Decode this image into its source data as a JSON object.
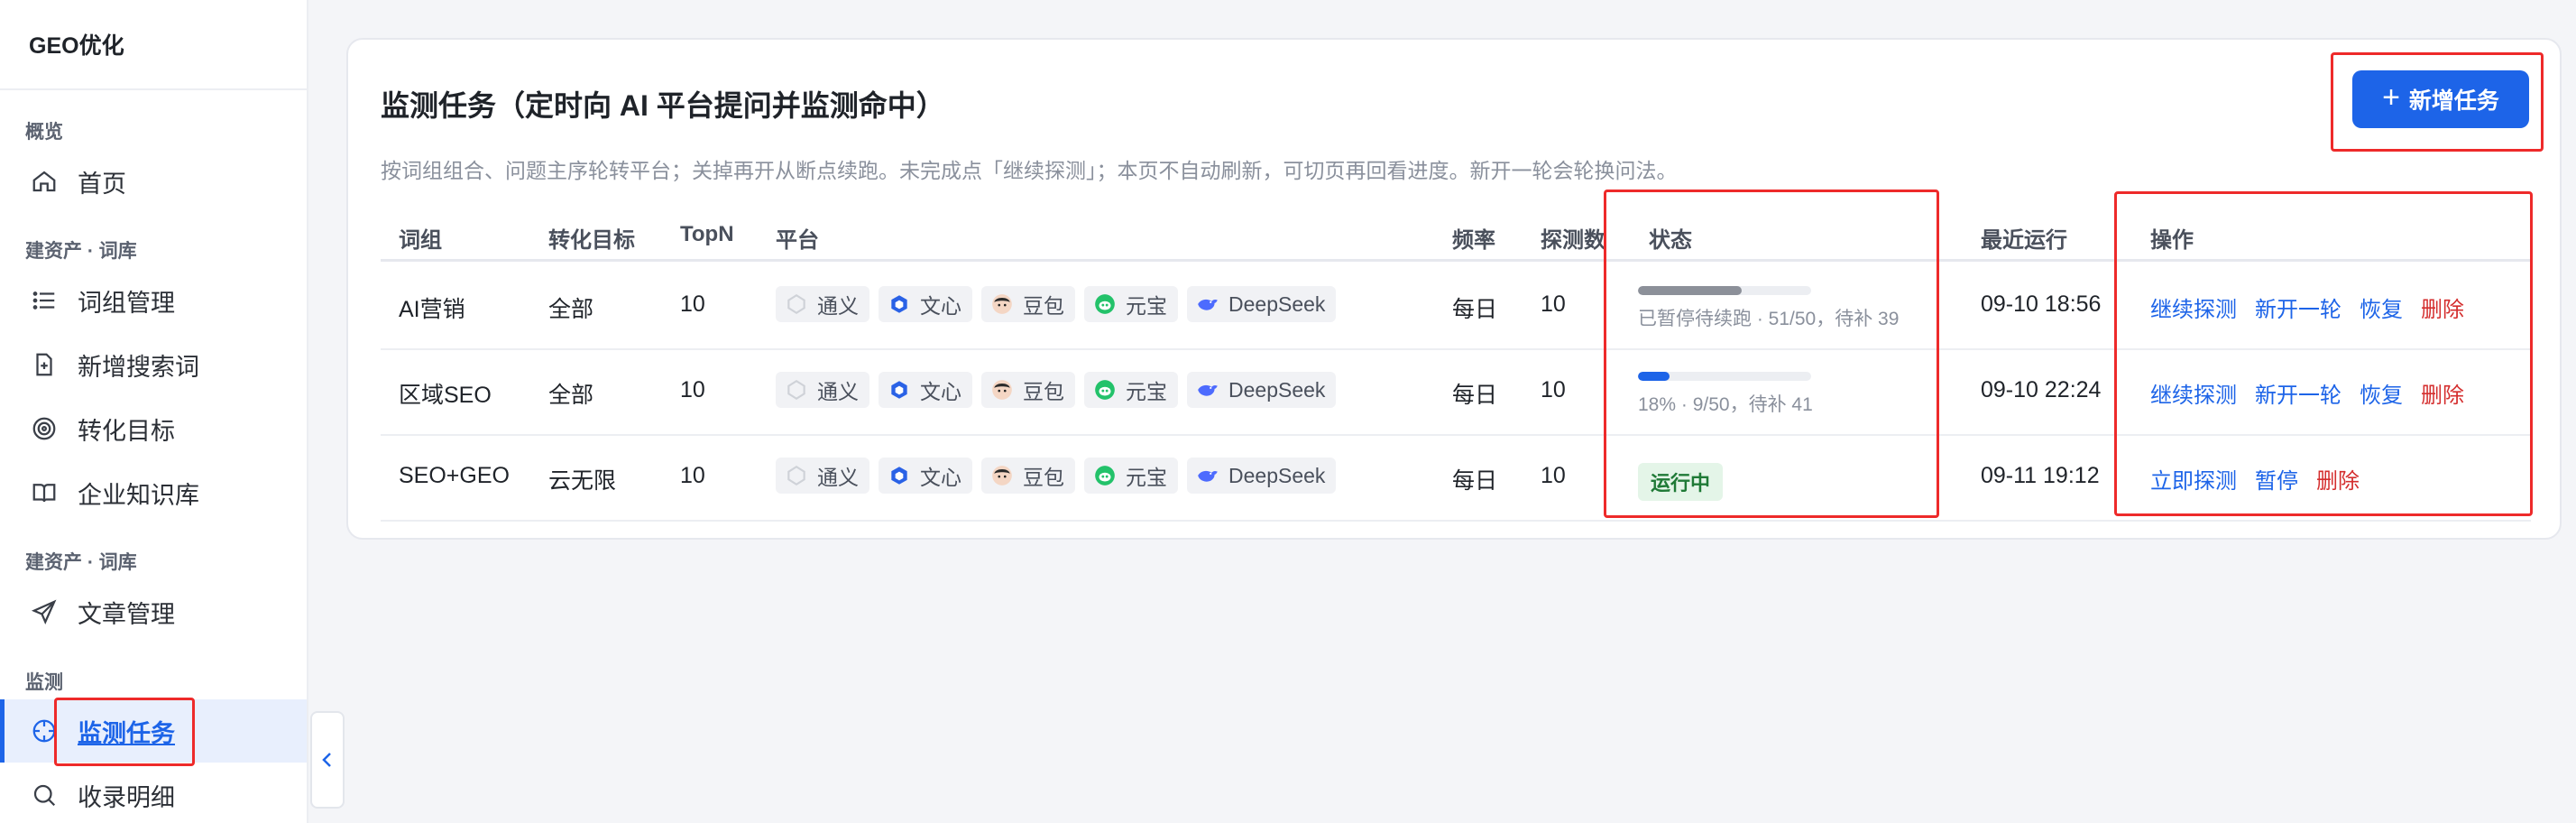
{
  "sidebar": {
    "brand": "GEO优化",
    "groups": [
      {
        "title": "概览",
        "items": [
          {
            "label": "首页",
            "icon": "home-icon"
          }
        ]
      },
      {
        "title": "建资产 · 词库",
        "items": [
          {
            "label": "词组管理",
            "icon": "list-icon"
          },
          {
            "label": "新增搜索词",
            "icon": "file-plus-icon"
          },
          {
            "label": "转化目标",
            "icon": "target-icon"
          },
          {
            "label": "企业知识库",
            "icon": "book-icon"
          }
        ]
      },
      {
        "title": "建资产 · 词库",
        "items": [
          {
            "label": "文章管理",
            "icon": "send-icon"
          }
        ]
      },
      {
        "title": "监测",
        "items": [
          {
            "label": "监测任务",
            "icon": "crosshair-icon",
            "active": true
          },
          {
            "label": "收录明细",
            "icon": "search-icon"
          }
        ]
      }
    ]
  },
  "main": {
    "title": "监测任务（定时向 AI 平台提问并监测命中）",
    "subtitle": "按词组组合、问题主序轮转平台；关掉再开从断点续跑。未完成点「继续探测」；本页不自动刷新，可切页再回看进度。新开一轮会轮换问法。",
    "add_button": "新增任务",
    "columns": [
      "词组",
      "转化目标",
      "TopN",
      "平台",
      "频率",
      "探测数",
      "状态",
      "最近运行",
      "操作"
    ],
    "platform_names": [
      "通义",
      "文心",
      "豆包",
      "元宝",
      "DeepSeek"
    ],
    "rows": [
      {
        "group": "AI营销",
        "target": "全部",
        "topn": "10",
        "freq": "每日",
        "probes": "10",
        "status_text": "已暂停待续跑 · 51/50，待补 39",
        "progress": 0.6,
        "progress_color": "#8c9099",
        "last_run": "09-10 18:56",
        "actions": [
          "继续探测",
          "新开一轮",
          "恢复",
          "删除"
        ]
      },
      {
        "group": "区域SEO",
        "target": "全部",
        "topn": "10",
        "freq": "每日",
        "probes": "10",
        "status_text": "18% · 9/50，待补 41",
        "progress": 0.18,
        "progress_color": "#1d64e8",
        "last_run": "09-10 22:24",
        "actions": [
          "继续探测",
          "新开一轮",
          "恢复",
          "删除"
        ]
      },
      {
        "group": "SEO+GEO",
        "target": "云无限",
        "topn": "10",
        "freq": "每日",
        "probes": "10",
        "status_badge": "运行中",
        "last_run": "09-11 19:12",
        "actions": [
          "立即探测",
          "暂停",
          "删除"
        ]
      }
    ]
  },
  "colors": {
    "accent": "#1d64e8",
    "danger": "#d42e2e",
    "running_badge": "#1f7a36",
    "highlight": "#ee2a2a"
  }
}
